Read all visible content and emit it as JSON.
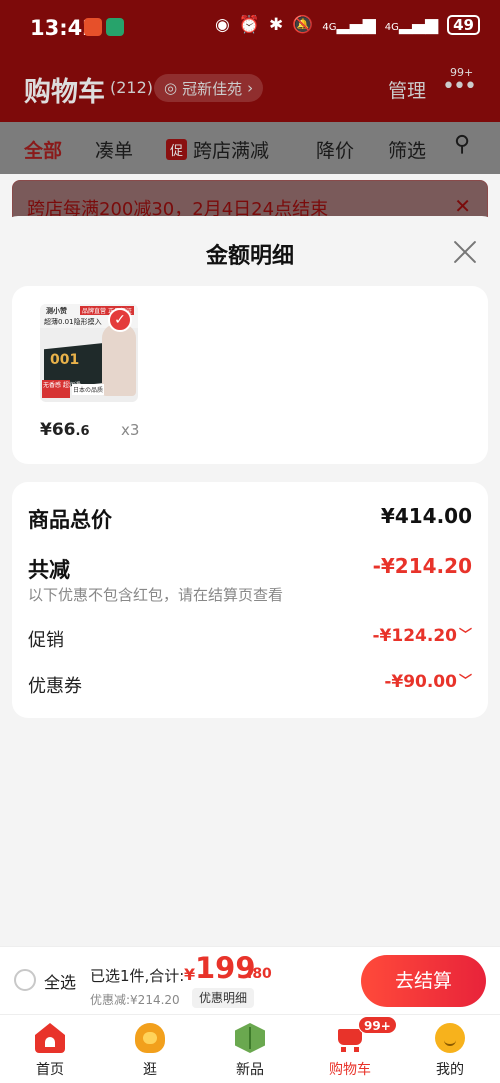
{
  "status_bar": {
    "time": "13:42",
    "net1": "4G",
    "net2": "4G",
    "battery": "49"
  },
  "header": {
    "title": "购物车",
    "count": "(212)",
    "store_name": "冠新佳苑",
    "manage_label": "管理",
    "more_badge": "99+"
  },
  "tabs": {
    "all": "全部",
    "combine": "凑单",
    "promo_tag": "促",
    "cross_store": "跨店满减",
    "price_drop": "降价",
    "filter": "筛选"
  },
  "banner": {
    "text": "跨店每满200减30，2月4日24点结束"
  },
  "sheet": {
    "title": "金额明细",
    "product": {
      "price_main": "¥66",
      "price_decimal": ".6",
      "quantity": "x3",
      "image_brand": "测小赞",
      "image_header": "品牌直营 正品保证",
      "image_subtitle": "超薄0.01隐形摸入",
      "image_number": "001",
      "image_red_text": "无香感 超润滑",
      "image_jp_text": "日本の品质"
    },
    "details": {
      "total_label": "商品总价",
      "total_value": "¥414.00",
      "reduced_label": "共减",
      "reduced_value": "-¥214.20",
      "note": "以下优惠不包含红包，请在结算页查看",
      "promo_label": "促销",
      "promo_value": "-¥124.20",
      "coupon_label": "优惠券",
      "coupon_value": "-¥90.00"
    }
  },
  "checkout": {
    "select_all_label": "全选",
    "selected_info": "已选1件,合计:",
    "currency": "¥",
    "total_int": "199",
    "total_dec": ".80",
    "discount_info": "优惠减:¥214.20",
    "detail_button": "优惠明细",
    "checkout_button": "去结算"
  },
  "bottom_nav": {
    "items": [
      {
        "label": "首页",
        "icon": "home-icon"
      },
      {
        "label": "逛",
        "icon": "stroll-icon"
      },
      {
        "label": "新品",
        "icon": "new-products-icon"
      },
      {
        "label": "购物车",
        "icon": "cart-icon"
      },
      {
        "label": "我的",
        "icon": "mine-icon"
      }
    ],
    "cart_badge": "99+"
  },
  "colors": {
    "accent_red": "#e8332a",
    "header_bg": "#7d0a0a"
  }
}
